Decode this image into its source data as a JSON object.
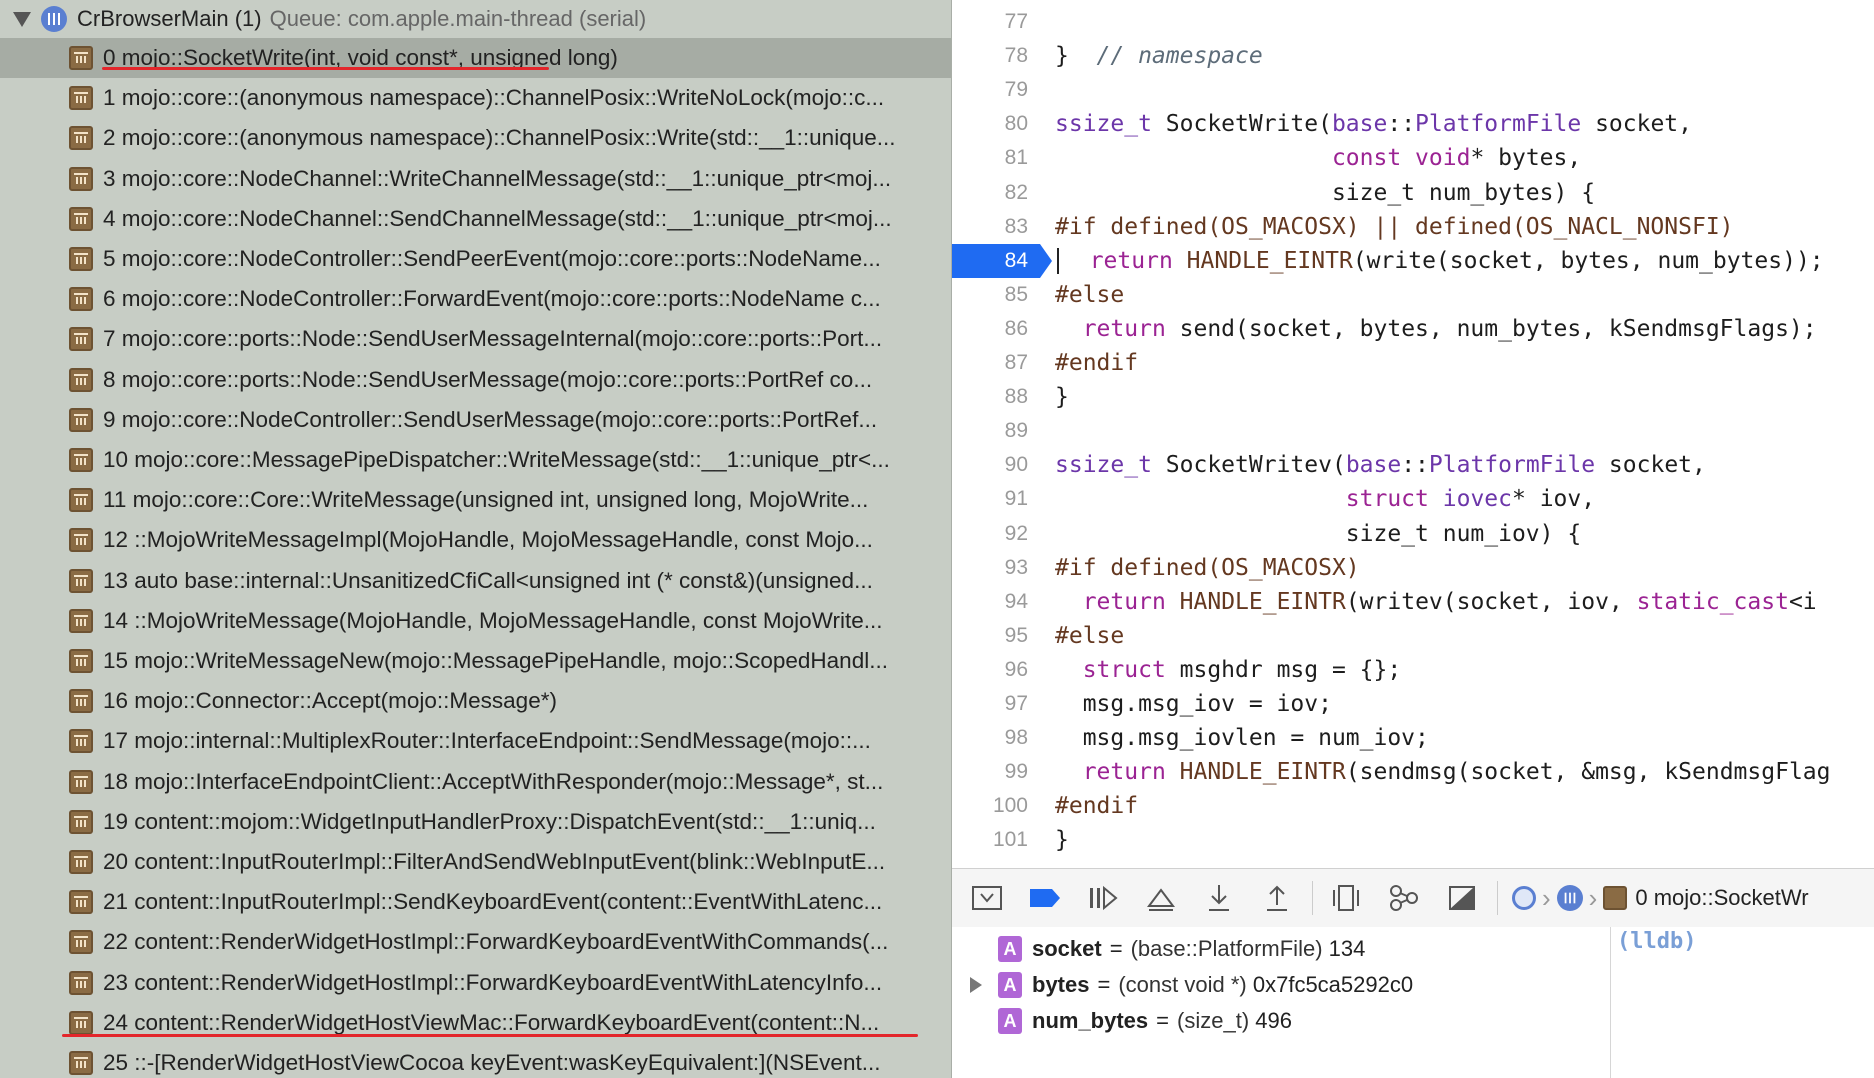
{
  "navigator": {
    "thread_name": "CrBrowserMain (1)",
    "thread_queue": "Queue: com.apple.main-thread (serial)",
    "frames": [
      "0 mojo::SocketWrite(int, void const*, unsigned long)",
      "1 mojo::core::(anonymous namespace)::ChannelPosix::WriteNoLock(mojo::c...",
      "2 mojo::core::(anonymous namespace)::ChannelPosix::Write(std::__1::unique...",
      "3 mojo::core::NodeChannel::WriteChannelMessage(std::__1::unique_ptr<moj...",
      "4 mojo::core::NodeChannel::SendChannelMessage(std::__1::unique_ptr<moj...",
      "5 mojo::core::NodeController::SendPeerEvent(mojo::core::ports::NodeName...",
      "6 mojo::core::NodeController::ForwardEvent(mojo::core::ports::NodeName c...",
      "7 mojo::core::ports::Node::SendUserMessageInternal(mojo::core::ports::Port...",
      "8 mojo::core::ports::Node::SendUserMessage(mojo::core::ports::PortRef co...",
      "9 mojo::core::NodeController::SendUserMessage(mojo::core::ports::PortRef...",
      "10 mojo::core::MessagePipeDispatcher::WriteMessage(std::__1::unique_ptr<...",
      "11 mojo::core::Core::WriteMessage(unsigned int, unsigned long, MojoWrite...",
      "12 ::MojoWriteMessageImpl(MojoHandle, MojoMessageHandle, const Mojo...",
      "13 auto base::internal::UnsanitizedCfiCall<unsigned int (* const&)(unsigned...",
      "14 ::MojoWriteMessage(MojoHandle, MojoMessageHandle, const MojoWrite...",
      "15 mojo::WriteMessageNew(mojo::MessagePipeHandle, mojo::ScopedHandl...",
      "16 mojo::Connector::Accept(mojo::Message*)",
      "17 mojo::internal::MultiplexRouter::InterfaceEndpoint::SendMessage(mojo::...",
      "18 mojo::InterfaceEndpointClient::AcceptWithResponder(mojo::Message*, st...",
      "19 content::mojom::WidgetInputHandlerProxy::DispatchEvent(std::__1::uniq...",
      "20 content::InputRouterImpl::FilterAndSendWebInputEvent(blink::WebInputE...",
      "21 content::InputRouterImpl::SendKeyboardEvent(content::EventWithLatenc...",
      "22 content::RenderWidgetHostImpl::ForwardKeyboardEventWithCommands(...",
      "23 content::RenderWidgetHostImpl::ForwardKeyboardEventWithLatencyInfo...",
      "24 content::RenderWidgetHostViewMac::ForwardKeyboardEvent(content::N...",
      "25 ::-[RenderWidgetHostViewCocoa keyEvent:wasKeyEquivalent:](NSEvent..."
    ]
  },
  "editor": {
    "current_line": "84",
    "lines": [
      {
        "n": "77",
        "html": ""
      },
      {
        "n": "78",
        "html": "}  <span class=\"cm\">// namespace</span>"
      },
      {
        "n": "79",
        "html": ""
      },
      {
        "n": "80",
        "html": "<span class=\"ty\">ssize_t</span> SocketWrite(<span class=\"ns\">base</span>::<span class=\"ty\">PlatformFile</span> socket,"
      },
      {
        "n": "81",
        "html": "                    <span class=\"kw\">const void</span>* bytes,"
      },
      {
        "n": "82",
        "html": "                    size_t num_bytes) {"
      },
      {
        "n": "83",
        "html": "<span class=\"pp\">#if defined(OS_MACOSX) || defined(OS_NACL_NONSFI)</span>"
      },
      {
        "n": "84",
        "html": "  <span class=\"kw\">return</span> <span class=\"pp\">HANDLE_EINTR</span>(write(socket, bytes, num_bytes));"
      },
      {
        "n": "85",
        "html": "<span class=\"pp\">#else</span>"
      },
      {
        "n": "86",
        "html": "  <span class=\"kw\">return</span> send(socket, bytes, num_bytes, kSendmsgFlags);"
      },
      {
        "n": "87",
        "html": "<span class=\"pp\">#endif</span>"
      },
      {
        "n": "88",
        "html": "}"
      },
      {
        "n": "89",
        "html": ""
      },
      {
        "n": "90",
        "html": "<span class=\"ty\">ssize_t</span> SocketWritev(<span class=\"ns\">base</span>::<span class=\"ty\">PlatformFile</span> socket,"
      },
      {
        "n": "91",
        "html": "                     <span class=\"kw\">struct</span> <span class=\"ty\">iovec</span>* iov,"
      },
      {
        "n": "92",
        "html": "                     size_t num_iov) {"
      },
      {
        "n": "93",
        "html": "<span class=\"pp\">#if defined(OS_MACOSX)</span>"
      },
      {
        "n": "94",
        "html": "  <span class=\"kw\">return</span> <span class=\"pp\">HANDLE_EINTR</span>(writev(socket, iov, <span class=\"kw\">static_cast</span>&lt;i"
      },
      {
        "n": "95",
        "html": "<span class=\"pp\">#else</span>"
      },
      {
        "n": "96",
        "html": "  <span class=\"kw\">struct</span> msghdr msg = {};"
      },
      {
        "n": "97",
        "html": "  msg.msg_iov = iov;"
      },
      {
        "n": "98",
        "html": "  msg.msg_iovlen = num_iov;"
      },
      {
        "n": "99",
        "html": "  <span class=\"kw\">return</span> <span class=\"pp\">HANDLE_EINTR</span>(sendmsg(socket, &amp;msg, kSendmsgFlag"
      },
      {
        "n": "100",
        "html": "<span class=\"pp\">#endif</span>"
      },
      {
        "n": "101",
        "html": "}"
      }
    ]
  },
  "debugbar": {
    "breadcrumb_frame": "0 mojo::SocketWr"
  },
  "variables": [
    {
      "name": "socket",
      "type": "(base::PlatformFile)",
      "value": "134",
      "expandable": false
    },
    {
      "name": "bytes",
      "type": "(const void *)",
      "value": "0x7fc5ca5292c0",
      "expandable": true
    },
    {
      "name": "num_bytes",
      "type": "(size_t)",
      "value": "496",
      "expandable": false
    }
  ],
  "variable_badge": "A",
  "console": {
    "prompt": "(lldb)"
  },
  "colors": {
    "accent": "#1f6bf2",
    "underline": "#e3262b",
    "navigator_bg": "#c7cdc5",
    "selected_bg": "#a6aca4"
  }
}
